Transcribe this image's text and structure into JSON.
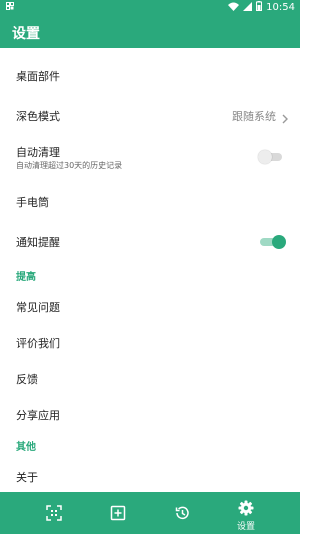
{
  "status_bar": {
    "time": "10:54"
  },
  "app_bar": {
    "title": "设置"
  },
  "settings": {
    "widgets": "桌面部件",
    "dark_mode": {
      "label": "深色模式",
      "value": "跟随系统"
    },
    "auto_clean": {
      "label": "自动清理",
      "sub": "自动清理超过30天的历史记录",
      "enabled": false
    },
    "flashlight": "手电筒",
    "notification": {
      "label": "通知提醒",
      "enabled": true
    }
  },
  "section_improve": {
    "title": "提高",
    "faq": "常见问题",
    "rate": "评价我们",
    "feedback": "反馈",
    "share": "分享应用"
  },
  "section_other": {
    "title": "其他",
    "about": "关于"
  },
  "bottom_nav": {
    "active_label": "设置",
    "items": [
      "scan-icon",
      "add-square-icon",
      "history-icon",
      "gear-icon"
    ]
  },
  "colors": {
    "primary": "#2aa97c"
  }
}
